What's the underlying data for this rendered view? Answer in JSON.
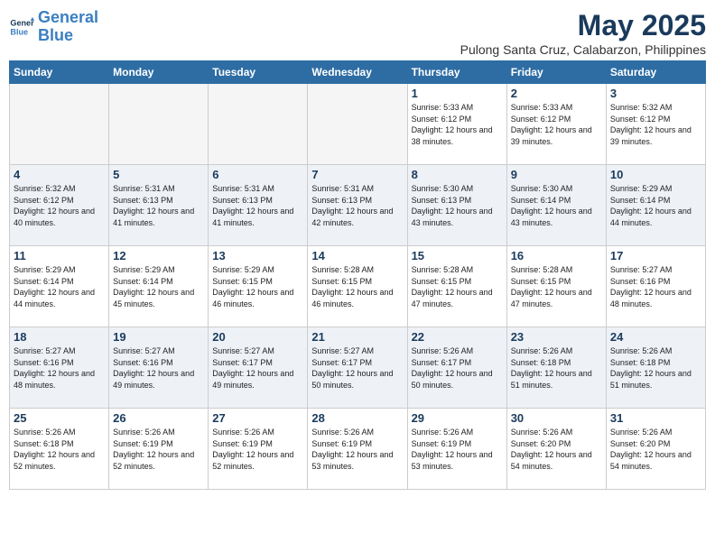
{
  "header": {
    "logo_line1": "General",
    "logo_line2": "Blue",
    "month_title": "May 2025",
    "location": "Pulong Santa Cruz, Calabarzon, Philippines"
  },
  "weekdays": [
    "Sunday",
    "Monday",
    "Tuesday",
    "Wednesday",
    "Thursday",
    "Friday",
    "Saturday"
  ],
  "weeks": [
    [
      {
        "day": "",
        "sunrise": "",
        "sunset": "",
        "daylight": "",
        "empty": true
      },
      {
        "day": "",
        "sunrise": "",
        "sunset": "",
        "daylight": "",
        "empty": true
      },
      {
        "day": "",
        "sunrise": "",
        "sunset": "",
        "daylight": "",
        "empty": true
      },
      {
        "day": "",
        "sunrise": "",
        "sunset": "",
        "daylight": "",
        "empty": true
      },
      {
        "day": "1",
        "sunrise": "5:33 AM",
        "sunset": "6:12 PM",
        "daylight": "12 hours and 38 minutes."
      },
      {
        "day": "2",
        "sunrise": "5:33 AM",
        "sunset": "6:12 PM",
        "daylight": "12 hours and 39 minutes."
      },
      {
        "day": "3",
        "sunrise": "5:32 AM",
        "sunset": "6:12 PM",
        "daylight": "12 hours and 39 minutes."
      }
    ],
    [
      {
        "day": "4",
        "sunrise": "5:32 AM",
        "sunset": "6:12 PM",
        "daylight": "12 hours and 40 minutes."
      },
      {
        "day": "5",
        "sunrise": "5:31 AM",
        "sunset": "6:13 PM",
        "daylight": "12 hours and 41 minutes."
      },
      {
        "day": "6",
        "sunrise": "5:31 AM",
        "sunset": "6:13 PM",
        "daylight": "12 hours and 41 minutes."
      },
      {
        "day": "7",
        "sunrise": "5:31 AM",
        "sunset": "6:13 PM",
        "daylight": "12 hours and 42 minutes."
      },
      {
        "day": "8",
        "sunrise": "5:30 AM",
        "sunset": "6:13 PM",
        "daylight": "12 hours and 43 minutes."
      },
      {
        "day": "9",
        "sunrise": "5:30 AM",
        "sunset": "6:14 PM",
        "daylight": "12 hours and 43 minutes."
      },
      {
        "day": "10",
        "sunrise": "5:29 AM",
        "sunset": "6:14 PM",
        "daylight": "12 hours and 44 minutes."
      }
    ],
    [
      {
        "day": "11",
        "sunrise": "5:29 AM",
        "sunset": "6:14 PM",
        "daylight": "12 hours and 44 minutes."
      },
      {
        "day": "12",
        "sunrise": "5:29 AM",
        "sunset": "6:14 PM",
        "daylight": "12 hours and 45 minutes."
      },
      {
        "day": "13",
        "sunrise": "5:29 AM",
        "sunset": "6:15 PM",
        "daylight": "12 hours and 46 minutes."
      },
      {
        "day": "14",
        "sunrise": "5:28 AM",
        "sunset": "6:15 PM",
        "daylight": "12 hours and 46 minutes."
      },
      {
        "day": "15",
        "sunrise": "5:28 AM",
        "sunset": "6:15 PM",
        "daylight": "12 hours and 47 minutes."
      },
      {
        "day": "16",
        "sunrise": "5:28 AM",
        "sunset": "6:15 PM",
        "daylight": "12 hours and 47 minutes."
      },
      {
        "day": "17",
        "sunrise": "5:27 AM",
        "sunset": "6:16 PM",
        "daylight": "12 hours and 48 minutes."
      }
    ],
    [
      {
        "day": "18",
        "sunrise": "5:27 AM",
        "sunset": "6:16 PM",
        "daylight": "12 hours and 48 minutes."
      },
      {
        "day": "19",
        "sunrise": "5:27 AM",
        "sunset": "6:16 PM",
        "daylight": "12 hours and 49 minutes."
      },
      {
        "day": "20",
        "sunrise": "5:27 AM",
        "sunset": "6:17 PM",
        "daylight": "12 hours and 49 minutes."
      },
      {
        "day": "21",
        "sunrise": "5:27 AM",
        "sunset": "6:17 PM",
        "daylight": "12 hours and 50 minutes."
      },
      {
        "day": "22",
        "sunrise": "5:26 AM",
        "sunset": "6:17 PM",
        "daylight": "12 hours and 50 minutes."
      },
      {
        "day": "23",
        "sunrise": "5:26 AM",
        "sunset": "6:18 PM",
        "daylight": "12 hours and 51 minutes."
      },
      {
        "day": "24",
        "sunrise": "5:26 AM",
        "sunset": "6:18 PM",
        "daylight": "12 hours and 51 minutes."
      }
    ],
    [
      {
        "day": "25",
        "sunrise": "5:26 AM",
        "sunset": "6:18 PM",
        "daylight": "12 hours and 52 minutes."
      },
      {
        "day": "26",
        "sunrise": "5:26 AM",
        "sunset": "6:19 PM",
        "daylight": "12 hours and 52 minutes."
      },
      {
        "day": "27",
        "sunrise": "5:26 AM",
        "sunset": "6:19 PM",
        "daylight": "12 hours and 52 minutes."
      },
      {
        "day": "28",
        "sunrise": "5:26 AM",
        "sunset": "6:19 PM",
        "daylight": "12 hours and 53 minutes."
      },
      {
        "day": "29",
        "sunrise": "5:26 AM",
        "sunset": "6:19 PM",
        "daylight": "12 hours and 53 minutes."
      },
      {
        "day": "30",
        "sunrise": "5:26 AM",
        "sunset": "6:20 PM",
        "daylight": "12 hours and 54 minutes."
      },
      {
        "day": "31",
        "sunrise": "5:26 AM",
        "sunset": "6:20 PM",
        "daylight": "12 hours and 54 minutes."
      }
    ]
  ],
  "labels": {
    "sunrise_prefix": "Sunrise: ",
    "sunset_prefix": "Sunset: ",
    "daylight_prefix": "Daylight: "
  }
}
